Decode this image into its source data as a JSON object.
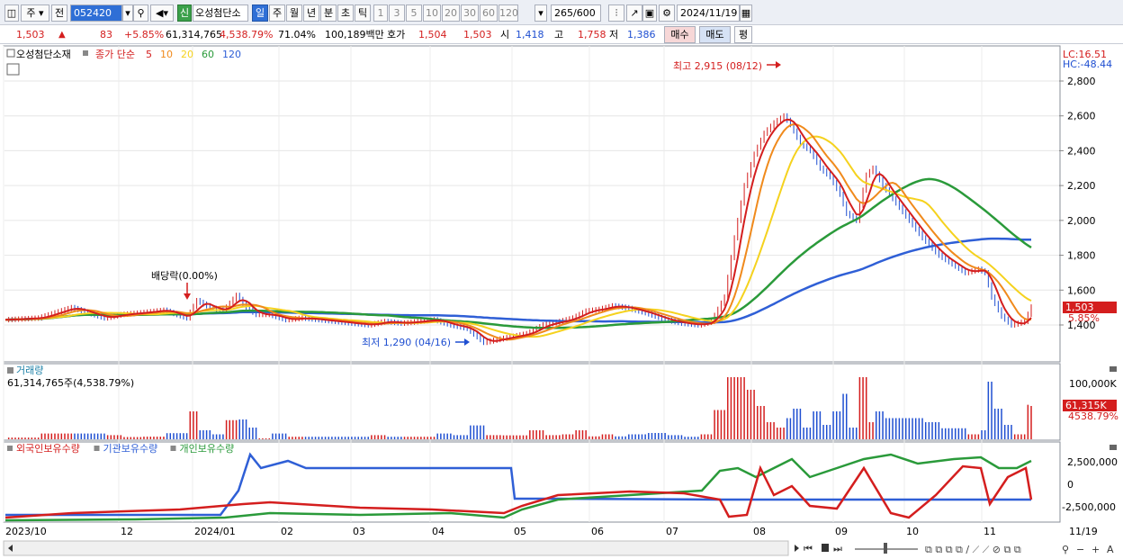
{
  "toolbar": {
    "type_label": "주",
    "prev_label": "전",
    "code": "052420",
    "name": "오성첨단소",
    "sin_label": "신",
    "periods": [
      "일",
      "주",
      "월",
      "년",
      "분",
      "초",
      "틱"
    ],
    "active_period": "일",
    "intervals": [
      "1",
      "3",
      "5",
      "10",
      "20",
      "30",
      "60",
      "120"
    ],
    "count": "265",
    "count_total": "/600",
    "date": "2024/11/19"
  },
  "quote": {
    "price": "1,503",
    "change": "83",
    "change_pct": "+5.85%",
    "volume": "61,314,765",
    "volume_pct": "4,538.79%",
    "turnover_rate": "71.04%",
    "amount": "100,189백만",
    "hoga_label": "호가",
    "ask": "1,504",
    "bid": "1,503",
    "open_label": "시",
    "open": "1,418",
    "high_label": "고",
    "high": "1,758",
    "low_label": "저",
    "low": "1,386",
    "buy_label": "매수",
    "sell_label": "매도",
    "eval_label": "평"
  },
  "chart_data": {
    "type": "line",
    "price_panel": {
      "title": "오성첨단소재",
      "ma_label": "종가 단순",
      "ma_periods": [
        "5",
        "10",
        "20",
        "60",
        "120"
      ],
      "ma_colors": [
        "#d41e1e",
        "#f08a1c",
        "#f5d21e",
        "#2a9a3a",
        "#2f5fd6"
      ],
      "lc_label": "LC:16.51",
      "hc_label": "HC:-48.44",
      "yticks": [
        "2,800",
        "2,600",
        "2,400",
        "2,200",
        "2,000",
        "1,800",
        "1,600",
        "1,400"
      ],
      "ytick_values": [
        2800,
        2600,
        2400,
        2200,
        2000,
        1800,
        1600,
        1400
      ],
      "ylim": [
        1250,
        2950
      ],
      "last_price": "1,503",
      "last_pct": "5.85%",
      "high_annotation": "최고 2,915 (08/12)",
      "low_annotation": "최저 1,290 (04/16)",
      "dividend_annotation": "배당락(0.00%)",
      "close_points": [
        [
          0,
          1430
        ],
        [
          10,
          1440
        ],
        [
          20,
          1500
        ],
        [
          25,
          1470
        ],
        [
          30,
          1440
        ],
        [
          35,
          1460
        ],
        [
          41,
          1470
        ],
        [
          48,
          1485
        ],
        [
          55,
          1440
        ],
        [
          58,
          1540
        ],
        [
          62,
          1500
        ],
        [
          66,
          1480
        ],
        [
          70,
          1570
        ],
        [
          73,
          1500
        ],
        [
          76,
          1460
        ],
        [
          80,
          1460
        ],
        [
          85,
          1430
        ],
        [
          90,
          1440
        ],
        [
          95,
          1430
        ],
        [
          100,
          1420
        ],
        [
          110,
          1400
        ],
        [
          115,
          1420
        ],
        [
          120,
          1410
        ],
        [
          130,
          1430
        ],
        [
          135,
          1400
        ],
        [
          140,
          1380
        ],
        [
          145,
          1300
        ],
        [
          150,
          1320
        ],
        [
          158,
          1350
        ],
        [
          163,
          1400
        ],
        [
          168,
          1420
        ],
        [
          172,
          1440
        ],
        [
          176,
          1480
        ],
        [
          180,
          1490
        ],
        [
          184,
          1510
        ],
        [
          188,
          1500
        ],
        [
          194,
          1470
        ],
        [
          200,
          1430
        ],
        [
          205,
          1410
        ],
        [
          210,
          1400
        ],
        [
          214,
          1420
        ],
        [
          218,
          1560
        ],
        [
          221,
          1900
        ],
        [
          224,
          2200
        ],
        [
          227,
          2380
        ],
        [
          230,
          2500
        ],
        [
          233,
          2560
        ],
        [
          236,
          2600
        ],
        [
          238,
          2550
        ],
        [
          241,
          2440
        ],
        [
          244,
          2400
        ],
        [
          247,
          2300
        ],
        [
          250,
          2250
        ],
        [
          253,
          2150
        ],
        [
          255,
          2040
        ],
        [
          258,
          2000
        ],
        [
          261,
          2260
        ],
        [
          263,
          2300
        ],
        [
          266,
          2200
        ],
        [
          270,
          2100
        ],
        [
          274,
          2000
        ],
        [
          278,
          1900
        ],
        [
          283,
          1800
        ],
        [
          287,
          1750
        ],
        [
          291,
          1700
        ],
        [
          295,
          1720
        ],
        [
          297,
          1700
        ],
        [
          299,
          1560
        ],
        [
          302,
          1450
        ],
        [
          305,
          1400
        ],
        [
          309,
          1420
        ],
        [
          311,
          1503
        ]
      ],
      "volume_panel": {
        "title": "거래량",
        "summary": "61,314,765주(4,538.79%)",
        "ytick": "100,000K",
        "last_volume": "61,315K",
        "last_pct": "4538.79%"
      },
      "holding_panel": {
        "series": [
          {
            "name": "외국인보유수량",
            "color": "#d41e1e"
          },
          {
            "name": "기관보유수량",
            "color": "#2f5fd6"
          },
          {
            "name": "개인보유수량",
            "color": "#2a9a3a"
          }
        ],
        "yticks": [
          "2,500,000",
          "0",
          "-2,500,000"
        ]
      },
      "x_labels": [
        "2023/10",
        "12",
        "2024/01",
        "02",
        "03",
        "04",
        "05",
        "06",
        "07",
        "08",
        "09",
        "10",
        "11",
        "11/19"
      ]
    }
  }
}
